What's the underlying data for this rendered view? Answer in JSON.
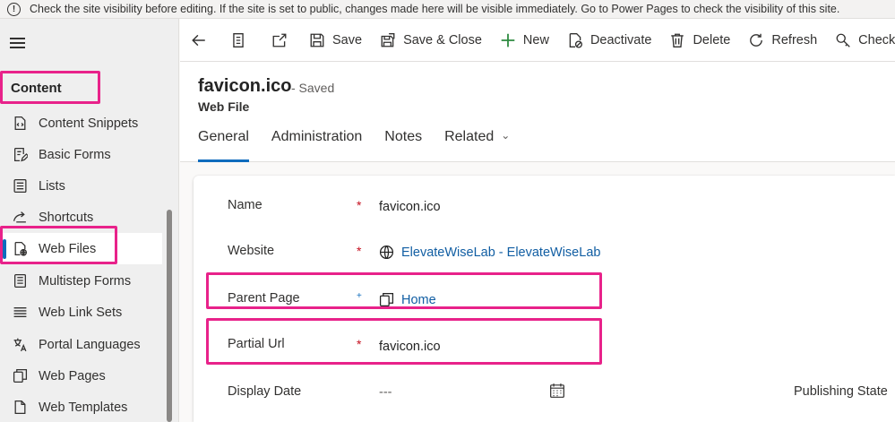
{
  "notice": {
    "icon": "info-icon",
    "text": "Check the site visibility before editing. If the site is set to public, changes made here will be visible immediately. Go to Power Pages to check the visibility of this site."
  },
  "sidebar": {
    "group_title": "Content",
    "items": [
      {
        "label": "Content Snippets",
        "icon": "code-file-icon"
      },
      {
        "label": "Basic Forms",
        "icon": "form-edit-icon"
      },
      {
        "label": "Lists",
        "icon": "list-icon"
      },
      {
        "label": "Shortcuts",
        "icon": "shortcut-icon"
      },
      {
        "label": "Web Files",
        "icon": "web-file-icon",
        "selected": true
      },
      {
        "label": "Multistep Forms",
        "icon": "document-list-icon"
      },
      {
        "label": "Web Link Sets",
        "icon": "lines-icon"
      },
      {
        "label": "Portal Languages",
        "icon": "language-icon"
      },
      {
        "label": "Web Pages",
        "icon": "pages-icon"
      },
      {
        "label": "Web Templates",
        "icon": "template-icon"
      }
    ]
  },
  "commands": {
    "save": "Save",
    "save_close": "Save & Close",
    "new": "New",
    "deactivate": "Deactivate",
    "delete": "Delete",
    "refresh": "Refresh",
    "check_access": "Check Acc"
  },
  "record": {
    "title": "favicon.ico",
    "status": "- Saved",
    "entity": "Web File"
  },
  "tabs": [
    "General",
    "Administration",
    "Notes",
    "Related"
  ],
  "form": {
    "name": {
      "label": "Name",
      "required": "*",
      "value": "favicon.ico"
    },
    "website": {
      "label": "Website",
      "required": "*",
      "value": "ElevateWiseLab - ElevateWiseLab"
    },
    "parent_page": {
      "label": "Parent Page",
      "required": "+",
      "value": "Home"
    },
    "partial_url": {
      "label": "Partial Url",
      "required": "*",
      "value": "favicon.ico"
    },
    "display_date": {
      "label": "Display Date",
      "value": "---"
    },
    "publishing_state": {
      "label": "Publishing State"
    }
  },
  "colors": {
    "accent": "#0f6cbd",
    "highlight": "#e8228a",
    "required": "#c50f1f",
    "link": "#115ea3"
  }
}
